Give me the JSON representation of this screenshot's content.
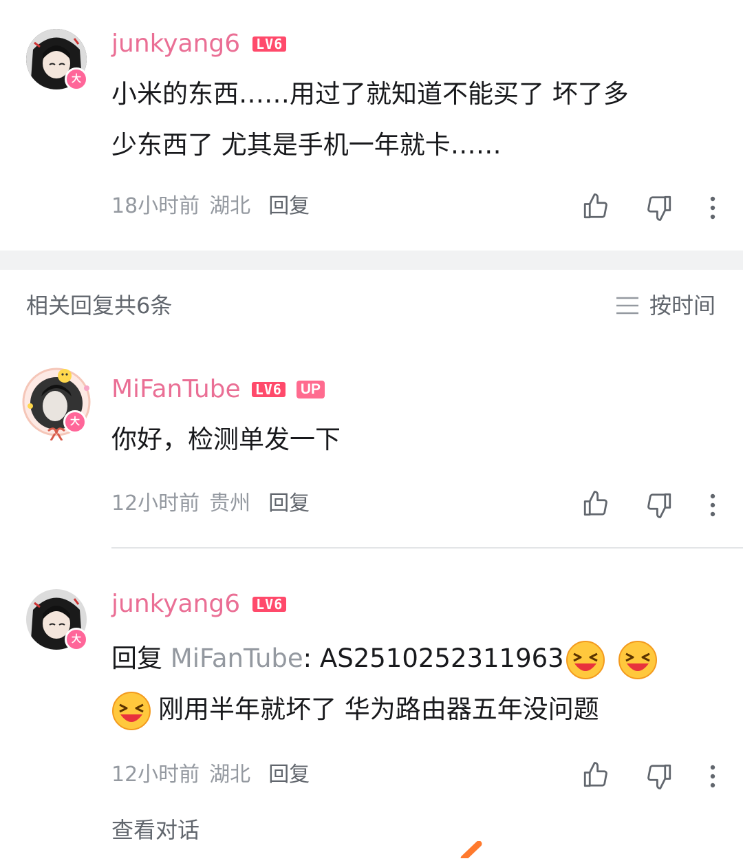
{
  "top_comment": {
    "username": "junkyang6",
    "level": "LV6",
    "avatar_badge": "大",
    "text_line1": "小米的东西……用过了就知道不能买了 坏了多",
    "text_line2": "少东西了 尤其是手机一年就卡……",
    "time": "18小时前",
    "location": "湖北",
    "reply_label": "回复"
  },
  "replies_header": {
    "title": "相关回复共6条",
    "sort_label": "按时间"
  },
  "replies": [
    {
      "username": "MiFanTube",
      "level": "LV6",
      "up_badge": "UP",
      "avatar_badge": "大",
      "text": "你好，检测单发一下",
      "time": "12小时前",
      "location": "贵州",
      "reply_label": "回复"
    },
    {
      "username": "junkyang6",
      "level": "LV6",
      "avatar_badge": "大",
      "reply_prefix": "回复",
      "mention": "MiFanTube",
      "text_line1_after_mention": ": AS2510252311963",
      "text_line2": "刚用半年就坏了 华为路由器五年没问题",
      "time": "12小时前",
      "location": "湖北",
      "reply_label": "回复"
    }
  ],
  "view_conversation": "查看对话",
  "icons": {
    "like": "thumbs-up-icon",
    "dislike": "thumbs-down-icon",
    "more": "more-vertical-icon",
    "sort": "menu-lines-icon",
    "emoji": "laughing-face-emoji"
  },
  "colors": {
    "username": "#ea6f95",
    "level_badge": "#ff4a6b",
    "meta_text": "#9499a0",
    "body_text": "#18191c"
  }
}
